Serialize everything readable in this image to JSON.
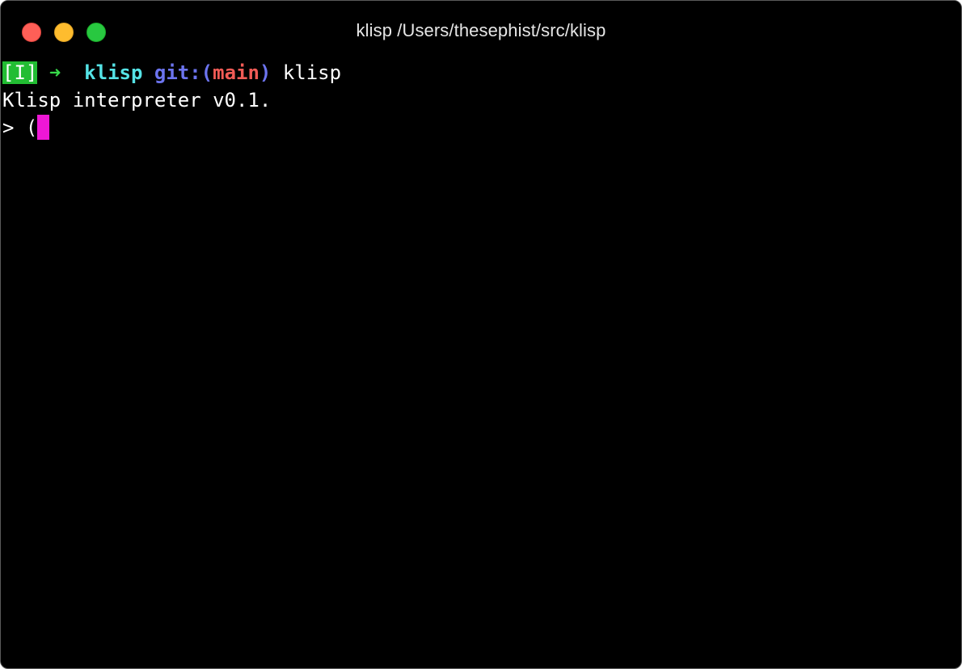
{
  "window": {
    "title": "klisp /Users/thesephist/src/klisp",
    "traffic_lights": {
      "close_color": "#fe5f57",
      "minimize_color": "#febc2e",
      "zoom_color": "#28c840"
    }
  },
  "terminal": {
    "prompt": {
      "mode": "[I]",
      "arrow": "➜",
      "directory": "klisp",
      "git_label": "git:(",
      "branch": "main",
      "git_close": ")",
      "command": "klisp"
    },
    "output_line": "Klisp interpreter v0.1.",
    "repl": {
      "prompt_symbol": ">",
      "input": "("
    },
    "colors": {
      "mode_badge": "#22bd33",
      "arrow": "#37d94a",
      "directory": "#55e3e6",
      "git": "#6c74ef",
      "branch": "#f25b56",
      "cursor": "#ee17d5"
    }
  }
}
